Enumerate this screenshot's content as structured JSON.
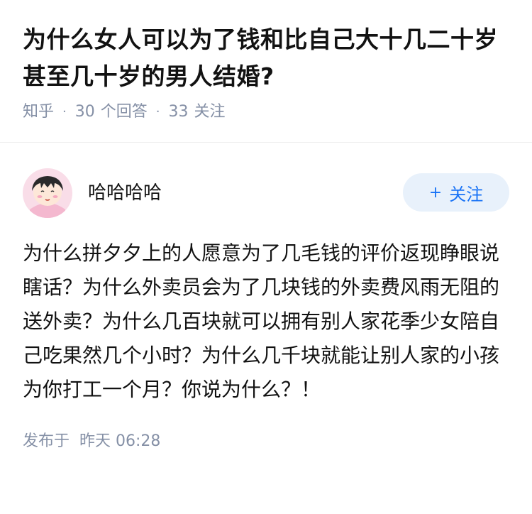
{
  "question": {
    "title": "为什么女人可以为了钱和比自己大十几二十岁甚至几十岁的男人结婚?",
    "source": "知乎",
    "answer_count": "30",
    "answer_label": "个回答",
    "follower_count": "33",
    "follower_label": "关注"
  },
  "answer": {
    "author_name": "哈哈哈哈",
    "follow_label": "关注",
    "content": "为什么拼夕夕上的人愿意为了几毛钱的评价返现睁眼说瞎话？为什么外卖员会为了几块钱的外卖费风雨无阻的送外卖？为什么几百块就可以拥有别人家花季少女陪自己吃果然几个小时？为什么几千块就能让别人家的小孩为你打工一个月？你说为什么？！",
    "publish_label": "发布于",
    "publish_time": "昨天 06:28"
  },
  "colors": {
    "meta_gray": "#8590a6",
    "accent_blue": "#1772f6",
    "follow_bg": "#e8f1fb"
  },
  "icons": {
    "avatar": "cartoon-girl-avatar",
    "follow": "plus-icon"
  }
}
